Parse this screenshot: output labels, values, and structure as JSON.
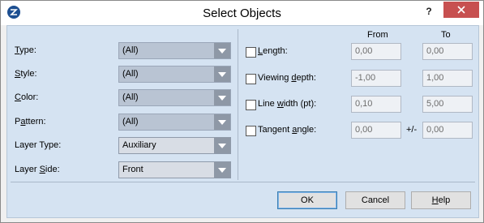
{
  "window": {
    "title": "Select Objects",
    "help_label": "?"
  },
  "left": {
    "rows": [
      {
        "pre": "",
        "ul": "T",
        "post": "ype:",
        "value": "(All)"
      },
      {
        "pre": "",
        "ul": "S",
        "post": "tyle:",
        "value": "(All)"
      },
      {
        "pre": "",
        "ul": "C",
        "post": "olor:",
        "value": "(All)"
      },
      {
        "pre": "P",
        "ul": "a",
        "post": "ttern:",
        "value": "(All)"
      },
      {
        "pre": "Layer Type:",
        "ul": "",
        "post": "",
        "value": "Auxiliary"
      },
      {
        "pre": "Layer ",
        "ul": "S",
        "post": "ide:",
        "value": "Front"
      }
    ]
  },
  "right": {
    "from_header": "From",
    "to_header": "To",
    "rows": [
      {
        "pre": "",
        "ul": "L",
        "post": "ength:",
        "from": "0,00",
        "to": "0,00",
        "sep": ""
      },
      {
        "pre": "Viewing ",
        "ul": "d",
        "post": "epth:",
        "from": "-1,00",
        "to": "1,00",
        "sep": ""
      },
      {
        "pre": "Line ",
        "ul": "w",
        "post": "idth (pt):",
        "from": "0,10",
        "to": "5,00",
        "sep": ""
      },
      {
        "pre": "Tangent ",
        "ul": "a",
        "post": "ngle:",
        "from": "0,00",
        "to": "0,00",
        "sep": "+/-"
      }
    ]
  },
  "buttons": {
    "ok": "OK",
    "cancel": "Cancel",
    "help": {
      "ul": "H",
      "post": "elp"
    }
  }
}
